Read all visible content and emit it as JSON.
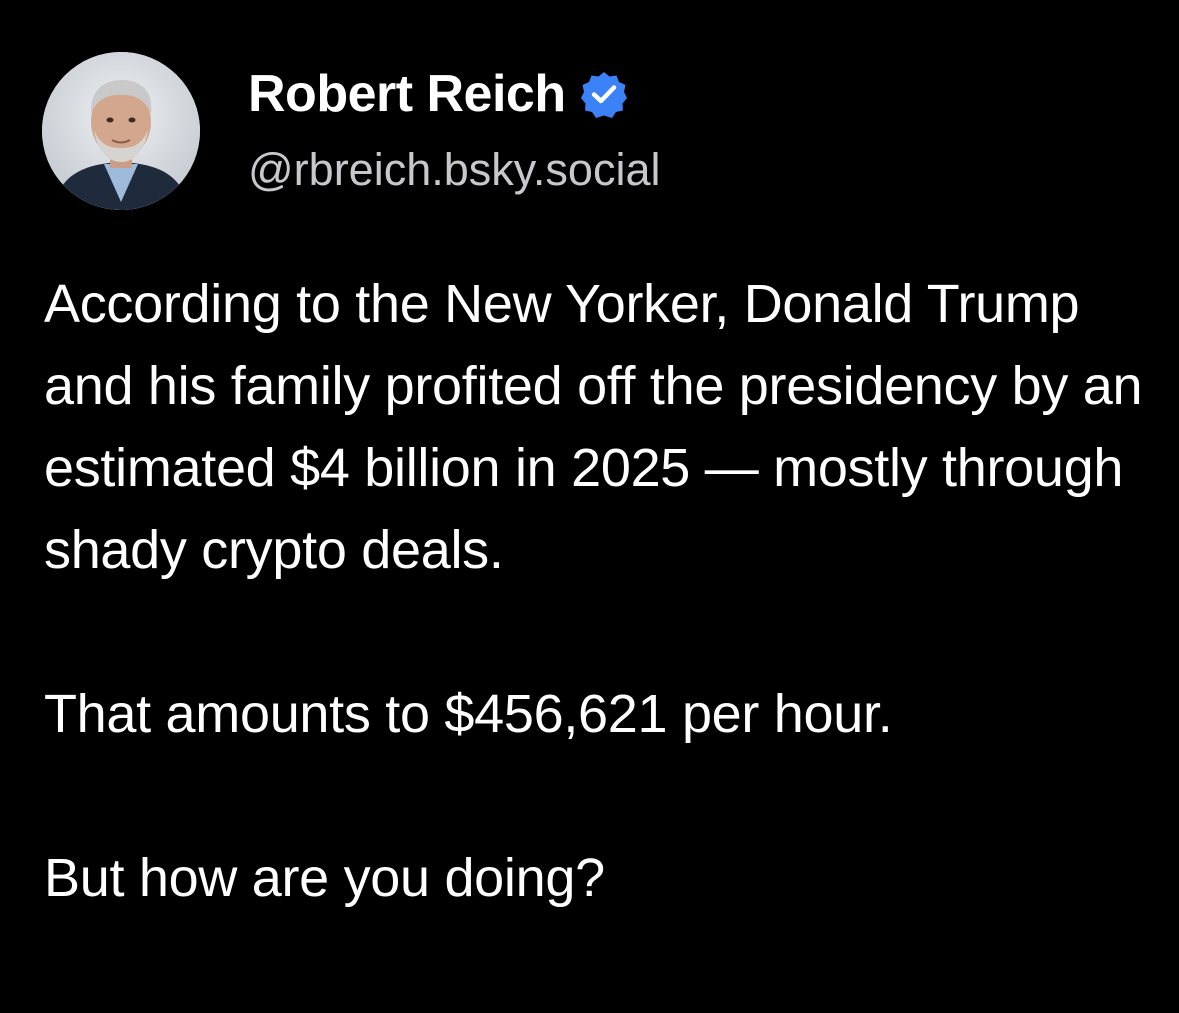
{
  "author": {
    "name": "Robert Reich",
    "handle": "@rbreich.bsky.social",
    "verified": true,
    "verified_badge_color": "#3b82f6"
  },
  "post": {
    "paragraphs": [
      "According to the New Yorker, Donald Trump and his family profited off the presidency by an estimated $4 billion in 2025 — mostly through shady crypto deals.",
      "That amounts to $456,621 per hour.",
      "But how are you doing?"
    ]
  },
  "theme": {
    "background": "#000000",
    "text": "#ffffff",
    "handle_text": "#c7c7cc"
  }
}
